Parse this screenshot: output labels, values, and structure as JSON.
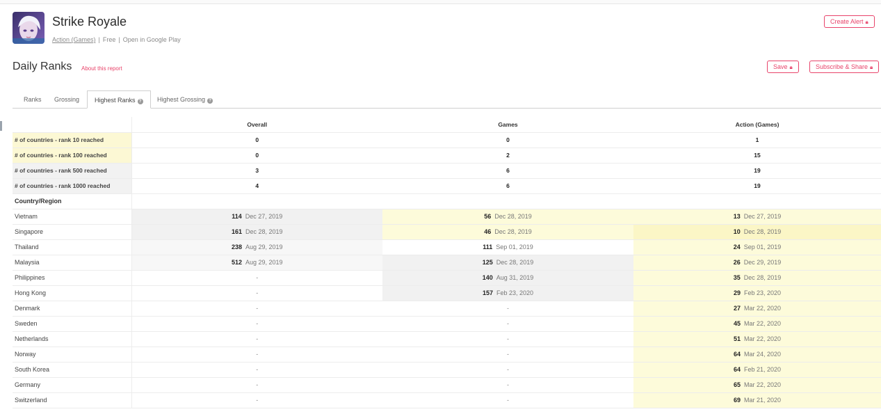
{
  "app": {
    "title": "Strike Royale",
    "category_link": "Action (Games)",
    "price": "Free",
    "store_link": "Open in Google Play"
  },
  "buttons": {
    "create_alert": "Create Alert",
    "save": "Save",
    "subscribe_share": "Subscribe & Share",
    "lock_icon": "lock-icon"
  },
  "report": {
    "title": "Daily Ranks",
    "about": "About this report"
  },
  "tabs": [
    {
      "label": "Ranks"
    },
    {
      "label": "Grossing"
    },
    {
      "label": "Highest Ranks"
    },
    {
      "label": "Highest Grossing"
    }
  ],
  "table": {
    "columns": [
      "Overall",
      "Games",
      "Action (Games)"
    ],
    "summary": [
      {
        "label": "# of countries - rank 10 reached",
        "values": [
          "0",
          "0",
          "1"
        ]
      },
      {
        "label": "# of countries - rank 100 reached",
        "values": [
          "0",
          "2",
          "15"
        ]
      },
      {
        "label": "# of countries - rank 500 reached",
        "values": [
          "3",
          "6",
          "19"
        ]
      },
      {
        "label": "# of countries - rank 1000 reached",
        "values": [
          "4",
          "6",
          "19"
        ]
      }
    ],
    "country_header": "Country/Region",
    "rows": [
      {
        "country": "Vietnam",
        "overall": {
          "rank": "114",
          "date": "Dec 27, 2019"
        },
        "games": {
          "rank": "56",
          "date": "Dec 28, 2019"
        },
        "action": {
          "rank": "13",
          "date": "Dec 27, 2019"
        }
      },
      {
        "country": "Singapore",
        "overall": {
          "rank": "161",
          "date": "Dec 28, 2019"
        },
        "games": {
          "rank": "46",
          "date": "Dec 28, 2019"
        },
        "action": {
          "rank": "10",
          "date": "Dec 28, 2019"
        }
      },
      {
        "country": "Thailand",
        "overall": {
          "rank": "238",
          "date": "Aug 29, 2019"
        },
        "games": {
          "rank": "111",
          "date": "Sep 01, 2019"
        },
        "action": {
          "rank": "24",
          "date": "Sep 01, 2019"
        }
      },
      {
        "country": "Malaysia",
        "overall": {
          "rank": "512",
          "date": "Aug 29, 2019"
        },
        "games": {
          "rank": "125",
          "date": "Dec 28, 2019"
        },
        "action": {
          "rank": "26",
          "date": "Dec 29, 2019"
        }
      },
      {
        "country": "Philippines",
        "overall": {
          "rank": "-",
          "date": ""
        },
        "games": {
          "rank": "140",
          "date": "Aug 31, 2019"
        },
        "action": {
          "rank": "35",
          "date": "Dec 28, 2019"
        }
      },
      {
        "country": "Hong Kong",
        "overall": {
          "rank": "-",
          "date": ""
        },
        "games": {
          "rank": "157",
          "date": "Feb 23, 2020"
        },
        "action": {
          "rank": "29",
          "date": "Feb 23, 2020"
        }
      },
      {
        "country": "Denmark",
        "overall": {
          "rank": "-",
          "date": ""
        },
        "games": {
          "rank": "-",
          "date": ""
        },
        "action": {
          "rank": "27",
          "date": "Mar 22, 2020"
        }
      },
      {
        "country": "Sweden",
        "overall": {
          "rank": "-",
          "date": ""
        },
        "games": {
          "rank": "-",
          "date": ""
        },
        "action": {
          "rank": "45",
          "date": "Mar 22, 2020"
        }
      },
      {
        "country": "Netherlands",
        "overall": {
          "rank": "-",
          "date": ""
        },
        "games": {
          "rank": "-",
          "date": ""
        },
        "action": {
          "rank": "51",
          "date": "Mar 22, 2020"
        }
      },
      {
        "country": "Norway",
        "overall": {
          "rank": "-",
          "date": ""
        },
        "games": {
          "rank": "-",
          "date": ""
        },
        "action": {
          "rank": "64",
          "date": "Mar 24, 2020"
        }
      },
      {
        "country": "South Korea",
        "overall": {
          "rank": "-",
          "date": ""
        },
        "games": {
          "rank": "-",
          "date": ""
        },
        "action": {
          "rank": "64",
          "date": "Feb 21, 2020"
        }
      },
      {
        "country": "Germany",
        "overall": {
          "rank": "-",
          "date": ""
        },
        "games": {
          "rank": "-",
          "date": ""
        },
        "action": {
          "rank": "65",
          "date": "Mar 22, 2020"
        }
      },
      {
        "country": "Switzerland",
        "overall": {
          "rank": "-",
          "date": ""
        },
        "games": {
          "rank": "-",
          "date": ""
        },
        "action": {
          "rank": "69",
          "date": "Mar 21, 2020"
        }
      }
    ]
  },
  "colors": {
    "accent": "#e8436a",
    "highlight_yellow": "#fcf8d4",
    "highlight_gray": "#f2f2f2"
  }
}
